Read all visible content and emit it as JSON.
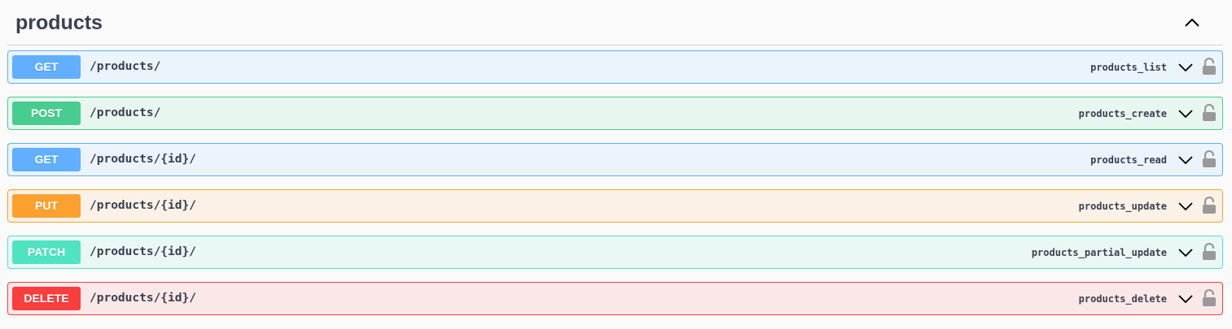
{
  "section": {
    "title": "products",
    "collapse_icon": "chevron-up-icon"
  },
  "operations": [
    {
      "method": "GET",
      "path": "/products/",
      "operation_id": "products_list",
      "color": "#61affe"
    },
    {
      "method": "POST",
      "path": "/products/",
      "operation_id": "products_create",
      "color": "#49cc90"
    },
    {
      "method": "GET",
      "path": "/products/{id}/",
      "operation_id": "products_read",
      "color": "#61affe"
    },
    {
      "method": "PUT",
      "path": "/products/{id}/",
      "operation_id": "products_update",
      "color": "#fca130"
    },
    {
      "method": "PATCH",
      "path": "/products/{id}/",
      "operation_id": "products_partial_update",
      "color": "#50e3c2"
    },
    {
      "method": "DELETE",
      "path": "/products/{id}/",
      "operation_id": "products_delete",
      "color": "#f93e3e"
    }
  ],
  "icons": {
    "expand": "chevron-down-icon",
    "auth": "unlocked-padlock-icon"
  }
}
